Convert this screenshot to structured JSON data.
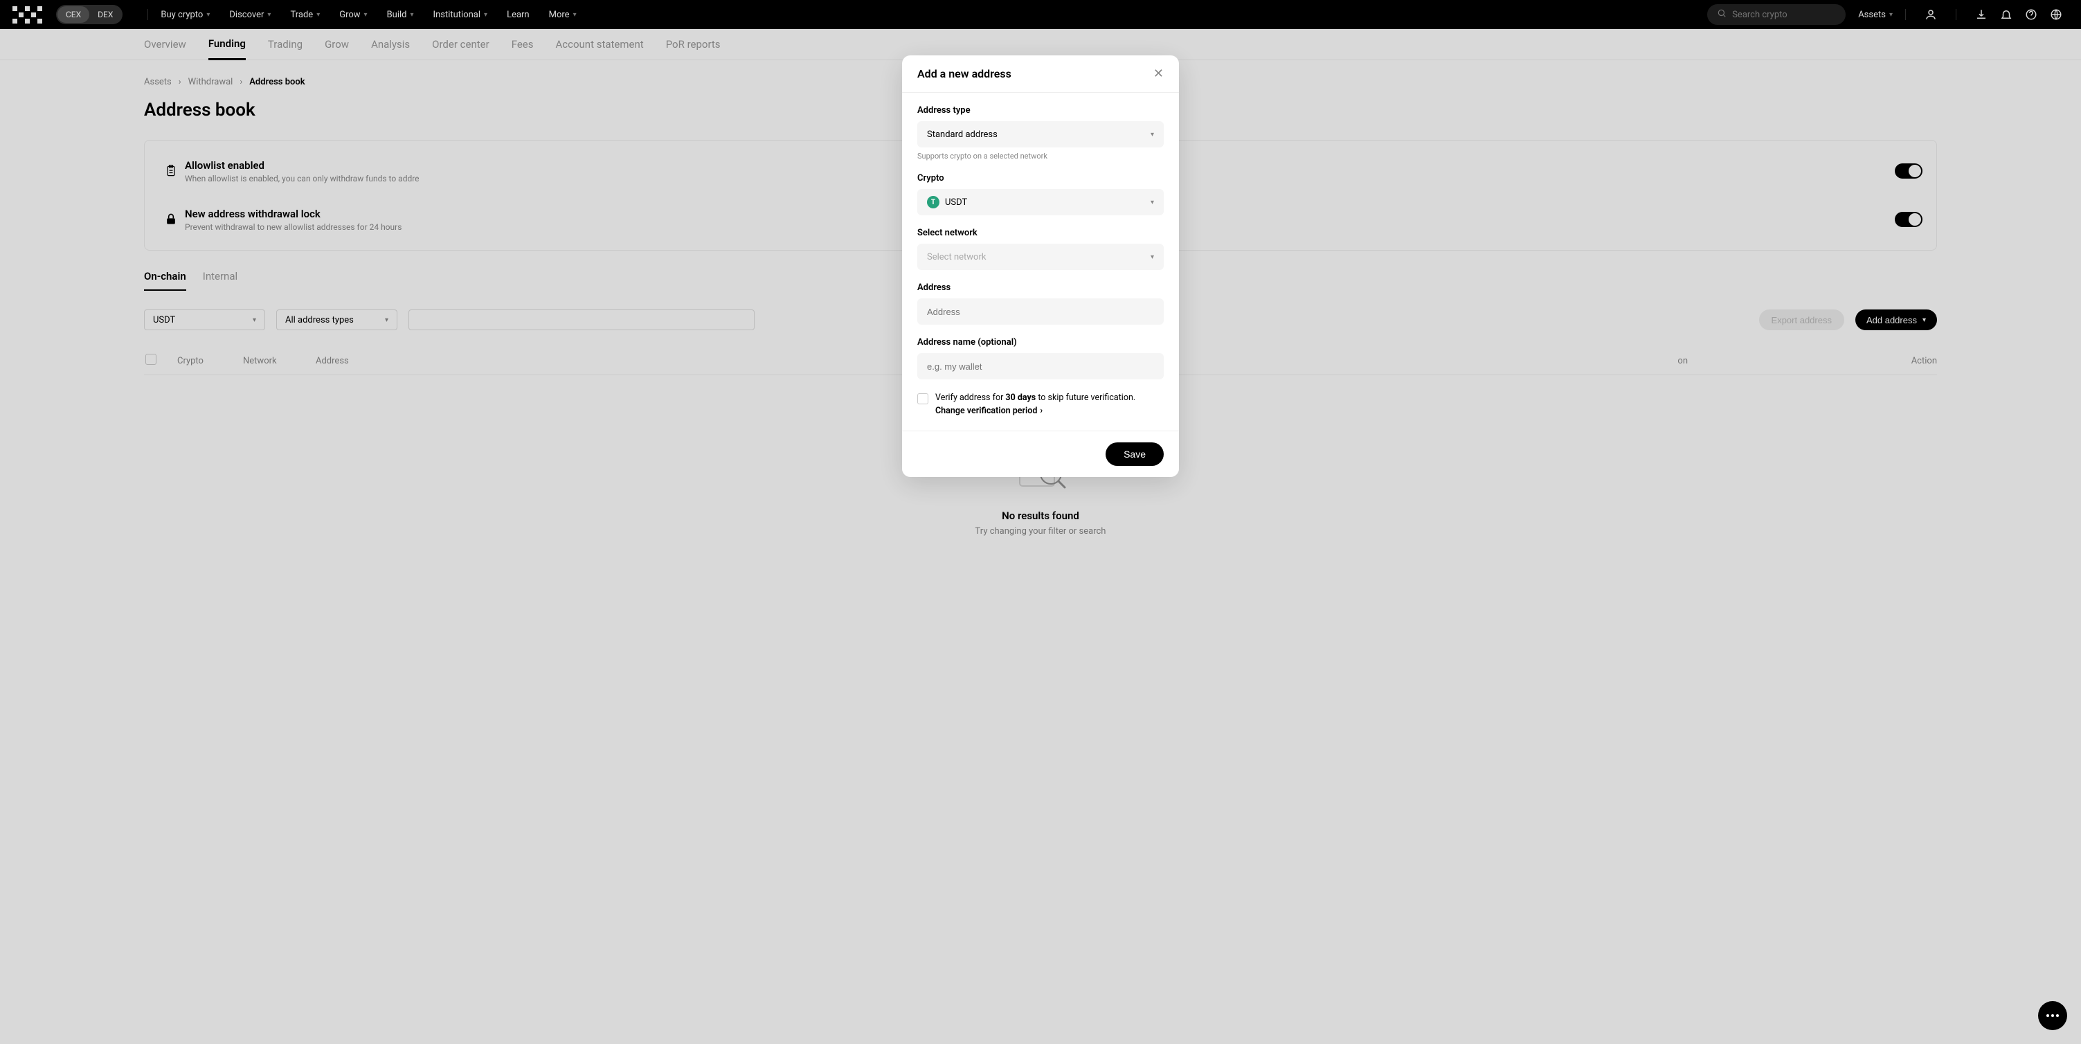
{
  "header": {
    "cex": "CEX",
    "dex": "DEX",
    "nav": [
      "Buy crypto",
      "Discover",
      "Trade",
      "Grow",
      "Build",
      "Institutional",
      "Learn",
      "More"
    ],
    "search_placeholder": "Search crypto",
    "assets": "Assets"
  },
  "subnav": {
    "items": [
      "Overview",
      "Funding",
      "Trading",
      "Grow",
      "Analysis",
      "Order center",
      "Fees",
      "Account statement",
      "PoR reports"
    ],
    "active": "Funding"
  },
  "breadcrumb": {
    "assets": "Assets",
    "withdrawal": "Withdrawal",
    "current": "Address book"
  },
  "page_title": "Address book",
  "settings": {
    "allowlist": {
      "title": "Allowlist enabled",
      "desc": "When allowlist is enabled, you can only withdraw funds to addre"
    },
    "lock": {
      "title": "New address withdrawal lock",
      "desc": "Prevent withdrawal to new allowlist addresses for 24 hours"
    }
  },
  "tabs": {
    "onchain": "On-chain",
    "internal": "Internal"
  },
  "filters": {
    "crypto": "USDT",
    "types": "All address types",
    "export": "Export address",
    "add": "Add address"
  },
  "table": {
    "cols": [
      "Crypto",
      "Network",
      "Address",
      "",
      "on",
      "Action"
    ]
  },
  "empty": {
    "title": "No results found",
    "desc": "Try changing your filter or search"
  },
  "modal": {
    "title": "Add a new address",
    "address_type_label": "Address type",
    "address_type_value": "Standard address",
    "address_type_hint": "Supports crypto on a selected network",
    "crypto_label": "Crypto",
    "crypto_value": "USDT",
    "network_label": "Select network",
    "network_placeholder": "Select network",
    "address_label": "Address",
    "address_placeholder": "Address",
    "name_label": "Address name (optional)",
    "name_placeholder": "e.g. my wallet",
    "verify_prefix": "Verify address for ",
    "verify_days": "30 days",
    "verify_suffix": " to skip future verification.",
    "change_period": "Change verification period",
    "save": "Save"
  }
}
